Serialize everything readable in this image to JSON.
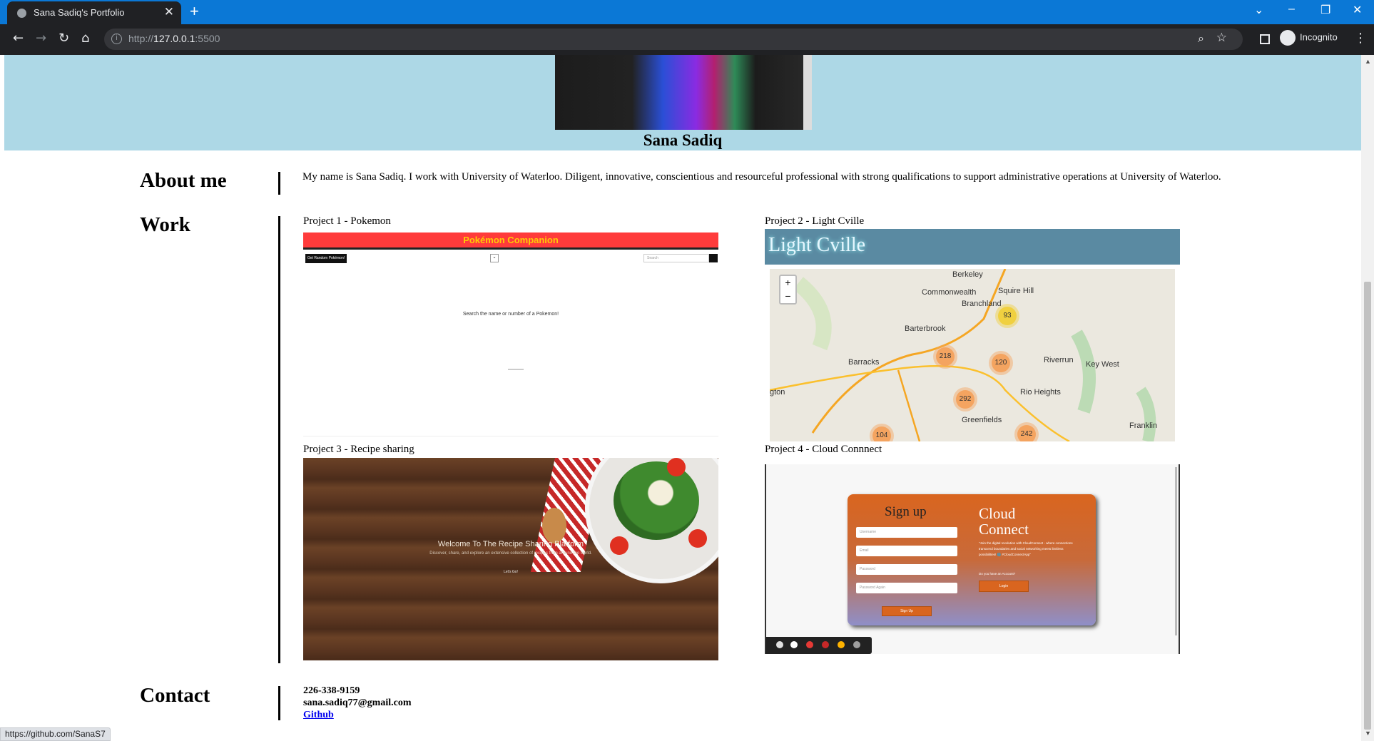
{
  "browser": {
    "tab_title": "Sana Sadiq's Portfolio",
    "tab_close": "✕",
    "new_tab": "+",
    "url_host": "127.0.0.1",
    "url_prefix": "http://",
    "url_port": ":5500",
    "profile": "Incognito",
    "status_url": "https://github.com/SanaS7"
  },
  "hero": {
    "name": "Sana Sadiq"
  },
  "about": {
    "heading": "About me",
    "text": "My name is Sana Sadiq. I work with University of Waterloo. Diligent, innovative, conscientious and resourceful professional with strong qualifications to support administrative operations at University of Waterloo."
  },
  "work": {
    "heading": "Work",
    "projects": [
      {
        "label": "Project 1 - Pokemon",
        "app_title": "Pokémon Companion",
        "random_button": "Get Random Pokémon!",
        "search_placeholder": "Search",
        "hint": "Search the name or number of a Pokemon!"
      },
      {
        "label": "Project 2 - Light Cville",
        "app_title": "Light Cville",
        "zoom_in": "+",
        "zoom_out": "−",
        "places": [
          "Berkeley",
          "Commonwealth",
          "Squire Hill",
          "Branchland",
          "Barterbrook",
          "Barracks",
          "Riverrun",
          "Key West",
          "Rio Heights",
          "Greenfields",
          "Franklin",
          "gton"
        ],
        "clusters": [
          "93",
          "218",
          "120",
          "292",
          "104",
          "242"
        ]
      },
      {
        "label": "Project 3 - Recipe sharing",
        "welcome": "Welcome To The Recipe Sharing Platform",
        "subtitle": "Discover, share, and explore an extensive collection of recipes from around the world.",
        "cta": "Let's Go!"
      },
      {
        "label": "Project 4 - Cloud Connnect",
        "signup_title": "Sign up",
        "fields": [
          "Username",
          "Email",
          "Password",
          "Password Again"
        ],
        "signup_button": "Sign Up",
        "brand_line1": "Cloud",
        "brand_line2": "Connect",
        "tagline": "\"Join the digital revolution with CloudConnect - where connections transcend boundaries and social networking meets limitless possibilities! 🌐 #CloudConnectApp\"",
        "question": "Do you have an Account?",
        "login_button": "Login"
      }
    ]
  },
  "contact": {
    "heading": "Contact",
    "phone": "226-338-9159",
    "email": "sana.sadiq77@gmail.com",
    "github": "Github"
  }
}
